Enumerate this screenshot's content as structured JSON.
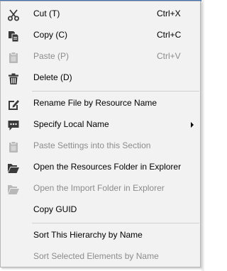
{
  "menu": {
    "items": [
      {
        "label": "Cut (T)",
        "shortcut": "Ctrl+X",
        "icon": "scissors-icon",
        "enabled": true
      },
      {
        "label": "Copy (C)",
        "shortcut": "Ctrl+C",
        "icon": "copy-icon",
        "enabled": true
      },
      {
        "label": "Paste (P)",
        "shortcut": "Ctrl+V",
        "icon": "paste-icon",
        "enabled": false
      },
      {
        "label": "Delete (D)",
        "shortcut": "",
        "icon": "trash-icon",
        "enabled": true
      },
      {
        "label": "Rename File by Resource Name",
        "shortcut": "",
        "icon": "rename-icon",
        "enabled": true
      },
      {
        "label": "Specify Local Name",
        "shortcut": "",
        "icon": "comment-icon",
        "enabled": true,
        "submenu": true
      },
      {
        "label": "Paste Settings into this Section",
        "shortcut": "",
        "icon": "clipboard-icon",
        "enabled": false
      },
      {
        "label": "Open the Resources Folder in Explorer",
        "shortcut": "",
        "icon": "folder-open-icon",
        "enabled": true
      },
      {
        "label": "Open the Import Folder in Explorer",
        "shortcut": "",
        "icon": "folder-open-icon",
        "enabled": false
      },
      {
        "label": "Copy GUID",
        "shortcut": "",
        "icon": "",
        "enabled": true
      },
      {
        "label": "Sort This Hierarchy by Name",
        "shortcut": "",
        "icon": "",
        "enabled": true
      },
      {
        "label": "Sort Selected Elements by Name",
        "shortcut": "",
        "icon": "",
        "enabled": false
      }
    ]
  },
  "colors": {
    "menu_background": "#f2f2f2",
    "disabled_text": "#8c8c8c",
    "icon_dark": "#3a3a3a",
    "icon_disabled": "#b8b8b8"
  }
}
